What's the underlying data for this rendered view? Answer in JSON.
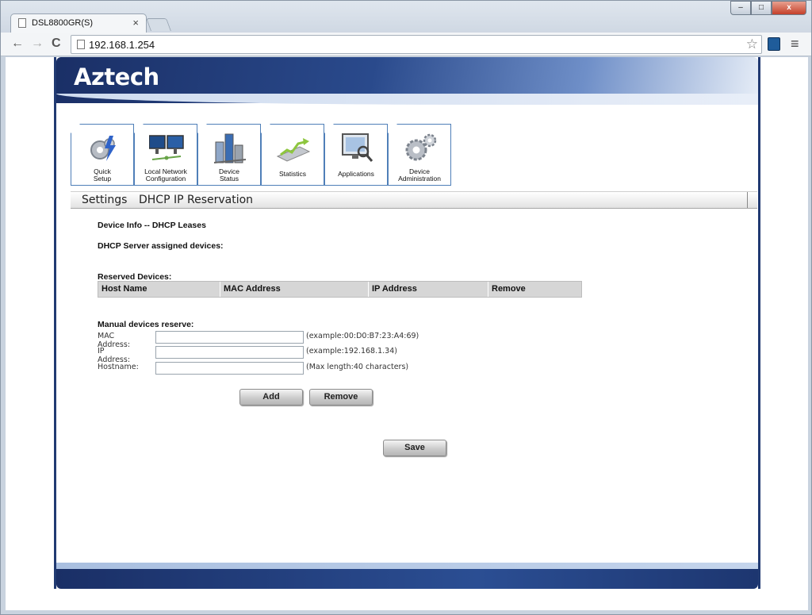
{
  "browser": {
    "tab_title": "DSL8800GR(S)",
    "tab_close": "×",
    "url": "192.168.1.254",
    "controls": {
      "minimize": "–",
      "maximize": "□",
      "close": "x"
    },
    "nav": {
      "back": "←",
      "forward": "→",
      "reload": "C"
    },
    "star": "☆",
    "menu": "≡"
  },
  "router": {
    "logo": "Aztech",
    "nav": [
      {
        "label1": "Quick",
        "label2": "Setup",
        "icon": "gears-lightning-icon"
      },
      {
        "label1": "Local Network",
        "label2": "Configuration",
        "icon": "monitors-icon"
      },
      {
        "label1": "Device",
        "label2": "Status",
        "icon": "buildings-chart-icon"
      },
      {
        "label1": "Statistics",
        "label2": "",
        "icon": "arrow-graph-icon"
      },
      {
        "label1": "Applications",
        "label2": "",
        "icon": "screen-magnifier-icon"
      },
      {
        "label1": "Device",
        "label2": "Administration",
        "icon": "gears-icon"
      }
    ],
    "breadcrumb": {
      "section": "Settings",
      "page": "DHCP IP Reservation"
    },
    "content": {
      "info_heading": "Device Info -- DHCP Leases",
      "dhcp_heading": "DHCP Server assigned devices:",
      "reserved_heading": "Reserved Devices:",
      "table_headers": [
        "Host Name",
        "MAC Address",
        "IP Address",
        "Remove"
      ],
      "manual_heading": "Manual devices reserve:",
      "fields": {
        "mac": {
          "label": "MAC Address:",
          "value": "",
          "hint": "(example:00:D0:B7:23:A4:69)"
        },
        "ip": {
          "label": "IP Address:",
          "value": "",
          "hint": "(example:192.168.1.34)"
        },
        "host": {
          "label": "Hostname:",
          "value": "",
          "hint": "(Max length:40 characters)"
        }
      },
      "buttons": {
        "add": "Add",
        "remove": "Remove",
        "save": "Save"
      }
    }
  }
}
